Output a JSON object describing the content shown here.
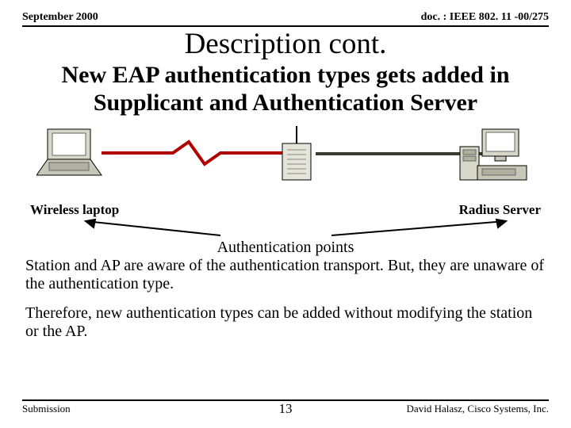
{
  "header": {
    "date": "September 2000",
    "docnum": "doc. : IEEE 802. 11 -00/275"
  },
  "title": "Description cont.",
  "subtitle": "New EAP authentication types gets added in Supplicant and Authentication Server",
  "labels": {
    "left": "Wireless laptop",
    "right": "Radius Server"
  },
  "auth_points_label": "Authentication points",
  "para1": "Station and AP are aware of the authentication transport. But, they are unaware of the authentication type.",
  "para2": "Therefore, new authentication types can be added without modifying the station or the AP.",
  "footer": {
    "left": "Submission",
    "center": "13",
    "right": "David Halasz, Cisco Systems, Inc."
  }
}
